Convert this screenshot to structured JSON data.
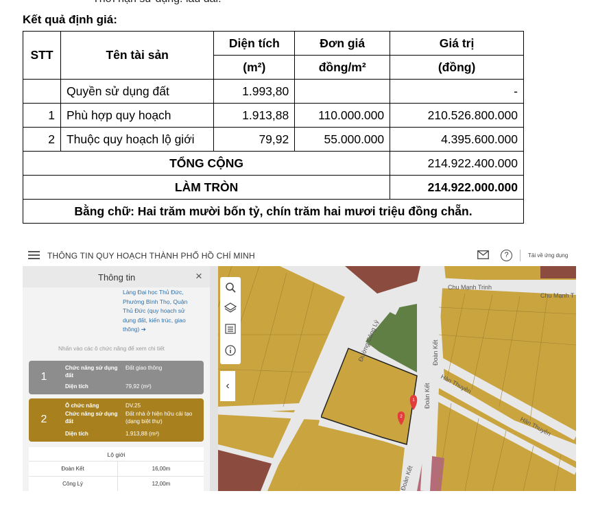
{
  "prev_line": "Thời hạn sử dụng: lâu dài.",
  "heading": "Kết quả định giá:",
  "table": {
    "h_stt": "STT",
    "h_name": "Tên tài sản",
    "h_area": "Diện tích",
    "h_area_unit": "(m²)",
    "h_price": "Đơn giá",
    "h_price_unit": "đồng/m²",
    "h_value": "Giá trị",
    "h_value_unit": "(đồng)",
    "rows": [
      {
        "stt": "",
        "name": "Quyền sử dụng đất",
        "area": "1.993,80",
        "price": "",
        "value": "-"
      },
      {
        "stt": "1",
        "name": "Phù hợp quy hoạch",
        "area": "1.913,88",
        "price": "110.000.000",
        "value": "210.526.800.000"
      },
      {
        "stt": "2",
        "name": "Thuộc quy hoạch lộ giới",
        "area": "79,92",
        "price": "55.000.000",
        "value": "4.395.600.000"
      }
    ],
    "total_label": "TỔNG CỘNG",
    "total_value": "214.922.400.000",
    "round_label": "LÀM TRÒN",
    "round_value": "214.922.000.000",
    "words": "Bằng chữ: Hai trăm mười bốn tỷ, chín trăm hai mươi triệu đồng chẵn."
  },
  "app": {
    "title": "THÔNG TIN QUY HOẠCH THÀNH PHỐ HỒ CHÍ MINH",
    "help": "?",
    "download": "Tải về ứng dụng",
    "panel_title": "Thông tin",
    "close": "×",
    "location_link": "Làng Đại học Thủ Đức, Phường Bình Thọ, Quận Thủ Đức (quy hoạch sử dụng đất, kiến trúc, giao thông) ➔",
    "hint": "Nhấn vào các ô chức năng để xem chi tiết",
    "card1": {
      "num": "1",
      "k1": "Chức năng sử dụng đất",
      "v1": "Đất giao thông",
      "k2": "Diện tích",
      "v2": "79,92 (m²)"
    },
    "card2": {
      "num": "2",
      "k0": "Ô chức năng",
      "v0": "DV.25",
      "k1": "Chức năng sử dụng đất",
      "v1": "Đất nhà ở hiện hữu cải tạo (dạng biệt thự)",
      "k2": "Diện tích",
      "v2": "1.913,88 (m²)"
    },
    "lo_gioi_title": "Lộ giới",
    "lo_gioi": [
      {
        "name": "Đoàn Kết",
        "width": "16,00m"
      },
      {
        "name": "Công Lý",
        "width": "12,00m"
      }
    ],
    "collapse": "‹"
  },
  "map_labels": {
    "chu_manh_trinh_1": "Chu Mạnh Trinh",
    "chu_manh_trinh_2": "Chu Mạnh T",
    "cong_ly": "Đường Công Lý",
    "doan_ket_1": "Đoàn Kết",
    "doan_ket_2": "Đoàn Kết",
    "doan_ket_3": "Đoàn Kết",
    "han_thuyen_1": "Hàn Thuyên",
    "han_thuyen_2": "Hàn Thuyên",
    "marker_1": "1",
    "marker_2": "2"
  },
  "colors": {
    "parcel": "#c9a43f",
    "road": "#e8e8e8",
    "green": "#5f7f45",
    "brown": "#8b4b3e",
    "card_gray": "#8d8d8d",
    "card_gold": "#a8811e",
    "marker": "#e23c3c"
  },
  "icons": [
    "menu-icon",
    "mail-icon",
    "help-icon",
    "close-icon",
    "search-icon",
    "layers-icon",
    "list-icon",
    "info-icon",
    "chevron-left-icon",
    "map-marker-icon"
  ]
}
